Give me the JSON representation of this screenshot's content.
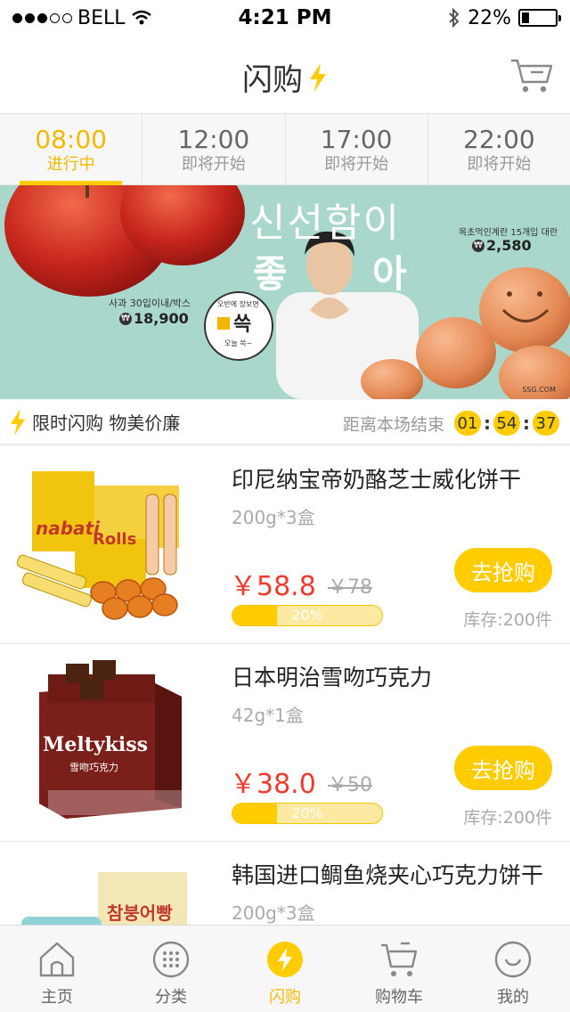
{
  "status_bar": {
    "carrier": "BELL",
    "time": "4:21 PM",
    "battery": "22%",
    "battery_level": 0.22,
    "signal_bars": 3
  },
  "nav": {
    "title": "闪购",
    "cart_icon": "cart-icon",
    "flash_icon": "lightning-icon"
  },
  "time_tabs": [
    {
      "time": "08:00",
      "state": "进行中",
      "active": true
    },
    {
      "time": "12:00",
      "state": "即将开始",
      "active": false
    },
    {
      "time": "17:00",
      "state": "即将开始",
      "active": false
    },
    {
      "time": "22:00",
      "state": "即将开始",
      "active": false
    }
  ],
  "banner": {
    "headline_line1": "신선함이",
    "headline_left": "좋",
    "headline_right": "아",
    "apple_caption": "사과 30입이내/박스",
    "apple_price": "18,900",
    "egg_caption": "목초먹인계란 15개입 대란",
    "egg_price": "2,580",
    "stamp_top": "오반에 장보면",
    "stamp_main": "쓱",
    "stamp_bottom": "오늘 쓱~",
    "brand": "SSG.COM",
    "currency_symbol": "₩",
    "brand_color": "#ffb400"
  },
  "flash_sale": {
    "title": "限时闪购 物美价廉",
    "countdown_label": "距离本场结束",
    "hours": "01",
    "minutes": "54",
    "seconds": "37"
  },
  "products": [
    {
      "name": "印尼纳宝帝奶酪芝士威化饼干",
      "spec": "200g*3盒",
      "price": "￥58.8",
      "old_price": "￥78",
      "progress_label": "20%",
      "progress": 0.3,
      "button": "去抢购",
      "stock": "库存:200件",
      "image_brand": "nabati",
      "image_sub": "Rolls"
    },
    {
      "name": "日本明治雪吻巧克力",
      "spec": "42g*1盒",
      "price": "￥38.0",
      "old_price": "￥50",
      "progress_label": "20%",
      "progress": 0.3,
      "button": "去抢购",
      "stock": "库存:200件",
      "image_brand": "Meltykiss",
      "image_sub": "雪吻巧克力"
    },
    {
      "name": "韩国进口鲷鱼烧夹心巧克力饼干",
      "spec": "200g*3盒",
      "price": "",
      "old_price": "",
      "progress_label": "",
      "progress": 0,
      "button": "",
      "stock": "",
      "image_brand": "참붕어빵",
      "image_sub": ""
    }
  ],
  "tab_bar": [
    {
      "label": "主页",
      "icon": "home-icon",
      "active": false
    },
    {
      "label": "分类",
      "icon": "category-icon",
      "active": false
    },
    {
      "label": "闪购",
      "icon": "flash-icon",
      "active": true
    },
    {
      "label": "购物车",
      "icon": "cart-icon",
      "active": false
    },
    {
      "label": "我的",
      "icon": "profile-icon",
      "active": false
    }
  ]
}
